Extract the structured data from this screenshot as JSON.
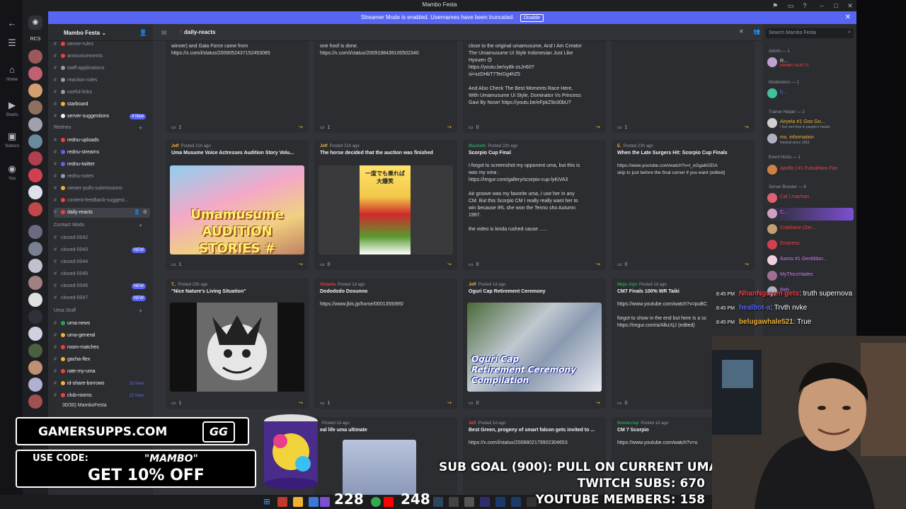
{
  "window": {
    "title": "Mambo Festa",
    "controls": [
      "–",
      "□",
      "✕"
    ]
  },
  "banner": {
    "text": "Streamer Mode is enabled. Usernames have been truncated.",
    "button": "Disable"
  },
  "outer_sidebar": {
    "items": [
      {
        "icon": "home-icon",
        "label": "Home"
      },
      {
        "icon": "shorts-icon",
        "label": "Shorts"
      },
      {
        "icon": "subscriptions-icon",
        "label": "Subscri"
      },
      {
        "icon": "you-icon",
        "label": "You"
      }
    ]
  },
  "rail": {
    "label": "RCS"
  },
  "guild": {
    "name": "Mambo Festa ⌄"
  },
  "channels": {
    "group1": [
      {
        "name": "server-rules",
        "dot": "#f23f43"
      },
      {
        "name": "announcements",
        "dot": "#f23f43"
      },
      {
        "name": "staff-applications",
        "dot": "#949ba4"
      },
      {
        "name": "reaction-roles",
        "dot": "#949ba4"
      },
      {
        "name": "useful-links",
        "dot": "#949ba4"
      },
      {
        "name": "starboard",
        "dot": "#f0b232",
        "bright": true
      },
      {
        "name": "server-suggestions",
        "dot": "#f2f3f5",
        "bright": true,
        "badge": "4 New"
      }
    ],
    "cat_rednu": "Redneu",
    "rednu": [
      {
        "name": "rednu-uploads",
        "dot": "#f23f43",
        "bright": true
      },
      {
        "name": "rednu-streams",
        "dot": "#5865f2",
        "bright": true
      },
      {
        "name": "rednu-twitter",
        "dot": "#5865f2",
        "bright": true
      },
      {
        "name": "rednu-notes",
        "dot": "#949ba4"
      },
      {
        "name": "viewer-pulls-submissions",
        "dot": "#f0b232"
      },
      {
        "name": "content-feedback-suggest...",
        "dot": "#f23f43"
      },
      {
        "name": "daily-reacts",
        "dot": "#f23f43",
        "active": true
      }
    ],
    "cat_contact": "Contact Mods",
    "contact": [
      {
        "name": "closed-0042"
      },
      {
        "name": "closed-0043",
        "badge": "NEW"
      },
      {
        "name": "closed-0044"
      },
      {
        "name": "closed-0045"
      },
      {
        "name": "closed-0046",
        "badge": "NEW"
      },
      {
        "name": "closed-0047",
        "badge": "NEW"
      }
    ],
    "cat_uma": "Uma Stuff",
    "uma": [
      {
        "name": "uma-news",
        "dot": "#23a559",
        "bright": true
      },
      {
        "name": "uma-general",
        "dot": "#f0b232",
        "bright": true
      },
      {
        "name": "room-matches",
        "dot": "#f23f43",
        "bright": true
      },
      {
        "name": "gacha-flex",
        "dot": "#f0b232",
        "bright": true
      },
      {
        "name": "rate-my-uma",
        "dot": "#f23f43",
        "bright": true
      },
      {
        "name": "id-share-borrows",
        "dot": "#f0b232",
        "bright": true,
        "badge_text": "33 New"
      },
      {
        "name": "club-rooms",
        "dot": "#f23f43",
        "bright": true,
        "badge_text": "22 New"
      }
    ],
    "footer": "30/30) MamboFesta"
  },
  "channel_header": {
    "name": "daily-reacts"
  },
  "search": {
    "placeholder": "Search Mambo Festa"
  },
  "cards_row0": [
    {
      "body": "winner) and Gaia Force came from\nhttps://x.com/i/status/2009052437152453085",
      "count": "1"
    },
    {
      "body": "one hoof is done.\nhttps://x.com/i/status/2009198439100502340",
      "count": "1"
    },
    {
      "body": "close to the original umamusume, And I Am Creator\nThe Umamusume Ui Style Indonesian Just Like\nHyouen 😊\nhttps://youtu.be/vy8k-zsJn60?\nsi=xzDHbT7TerDg4hZ5\n\nAnd Also Check The Best Moments Race Here,\nWith Umamusume Ui Style, Dominator Vs Princess\nGavi By Nose! https://youtu.be/eFpkZ9o30bU?",
      "count": "0"
    },
    {
      "body": "",
      "count": "1"
    }
  ],
  "cards_row1": [
    {
      "author": "Jeff",
      "posted": "Posted 21h ago",
      "title": "Uma Musume Voice Actresses Audition Story Volu...",
      "thumb_text": "Umamusume\nAUDITION STORIES #",
      "count": "1"
    },
    {
      "author": "Jeff",
      "posted": "Posted 21h ago",
      "title": "The horse decided that the auction was finished",
      "thumb_text": "一度でも乗れば\n大爆笑",
      "count": "0"
    },
    {
      "author": "Macbeth",
      "posted": "Posted 22h ago",
      "title": "Scorpio Cup Final",
      "body": "I forgot to screenshot my opponent uma, but this is\nwas my uma :\nhttps://imgur.com/gallery/scorpio-cup-lyKiVA3\n\nAir groove was my favorite uma, I use her in any\nCM. But this Scorpio CM I really really want her to\nwin because IRL she won the Tenno sho Autumn\n1997.\n\nthe video is kinda rushed cause ......",
      "count": "0"
    },
    {
      "author": "E.",
      "posted": "Posted 23h ago",
      "title": "When the Late Surgers Hit: Scorpio Cup Finals",
      "body": "https://www.youtube.com/watch?v=l_oGga6GEIA\nskip to just before the final corner if you want (edited)",
      "count": "0"
    }
  ],
  "cards_row2": [
    {
      "author": "T..",
      "posted": "Posted 23h ago",
      "title": "\"Nice Nature's Living Situation\"",
      "count": "1"
    },
    {
      "author": "Victoria",
      "posted": "Posted 1d ago",
      "title": "Dodododo Dosunno",
      "body": "https://www.jbis.jp/horse/0001359395/",
      "count": "1"
    },
    {
      "author": "Jeff",
      "posted": "Posted 1d ago",
      "title": "Oguri Cap Retirement Ceremony",
      "thumb_text": "Oguri Cap\nRetirement Ceremony Compilation",
      "count": "0"
    },
    {
      "author": "Mojo Jojo",
      "posted": "Posted 1d ago",
      "title": "CM7 Finals 100% WR Taiki",
      "body": "https://www.youtube.com/watch?v=puBC\n\nforgot to show in the end but here is a sc\nhttps://imgur.com/a/AlkzXjJ (edited)",
      "count": "0"
    }
  ],
  "cards_row3": [
    {
      "author": "",
      "posted": "Posted 1d ago",
      "title": "eal life uma ultimate"
    },
    {
      "author": "Jeff",
      "posted": "Posted 1d ago",
      "title": "Best Green, progeny of smart falcon gets invited to ...",
      "body": "https://x.com/i/status/2008802179902304653"
    },
    {
      "author": "Snowcrisp",
      "posted": "Posted 1d ago",
      "title": "CM 7 Scorpio",
      "body": "https://www.youtube.com/watch?v=u"
    }
  ],
  "members": {
    "admin_cat": "Admin — 1",
    "admin": [
      "R...",
      "MAMBO REACTS"
    ],
    "mod_cat": "Moderators — 1",
    "mod": "b...",
    "trainer_cat": "Trainer Helper — 2",
    "trainers": [
      "Airyela #1 Goo Go...",
      "ms. information"
    ],
    "trainer_sub": [
      "I live rent free in people's heads",
      "Neutral since 1815"
    ],
    "event_cat": "Event Hosts — 1",
    "event": "Apollo | #1 Fukukitaru Fan",
    "booster_cat": "Server Booster — 8",
    "boosters": [
      "Cal | machan",
      "C...",
      "Colebane (Zer...",
      "Empress",
      "Ikaros #1 Gentildon...",
      "MyThiccHades",
      "Reh"
    ]
  },
  "chat": [
    {
      "time": "8:45 PM",
      "user": "NhanNguyen gets",
      "msg": ": truth supernova"
    },
    {
      "time": "8:45 PM",
      "user": "healbot-a",
      "msg": ": Trvth nvke"
    },
    {
      "time": "8:45 PM",
      "user": "belugawhale521",
      "msg": ": True"
    }
  ],
  "ad": {
    "site": "GAMERSUPPS.COM",
    "use_code": "USE CODE:",
    "code": "\"MAMBO\"",
    "offer": "GET 10% OFF",
    "logo": "GG"
  },
  "sub_goal": {
    "line1": "SUB GOAL (900): PULL ON CURRENT UMA",
    "line2": "TWITCH SUBS: 670",
    "line3": "YOUTUBE MEMBERS: 158"
  },
  "taskbar": {
    "n1": "228",
    "n2": "248"
  },
  "colors": {
    "accent": "#5865f2",
    "bg": "#313338",
    "sidebar": "#2b2d31",
    "rail": "#1e1f22"
  }
}
